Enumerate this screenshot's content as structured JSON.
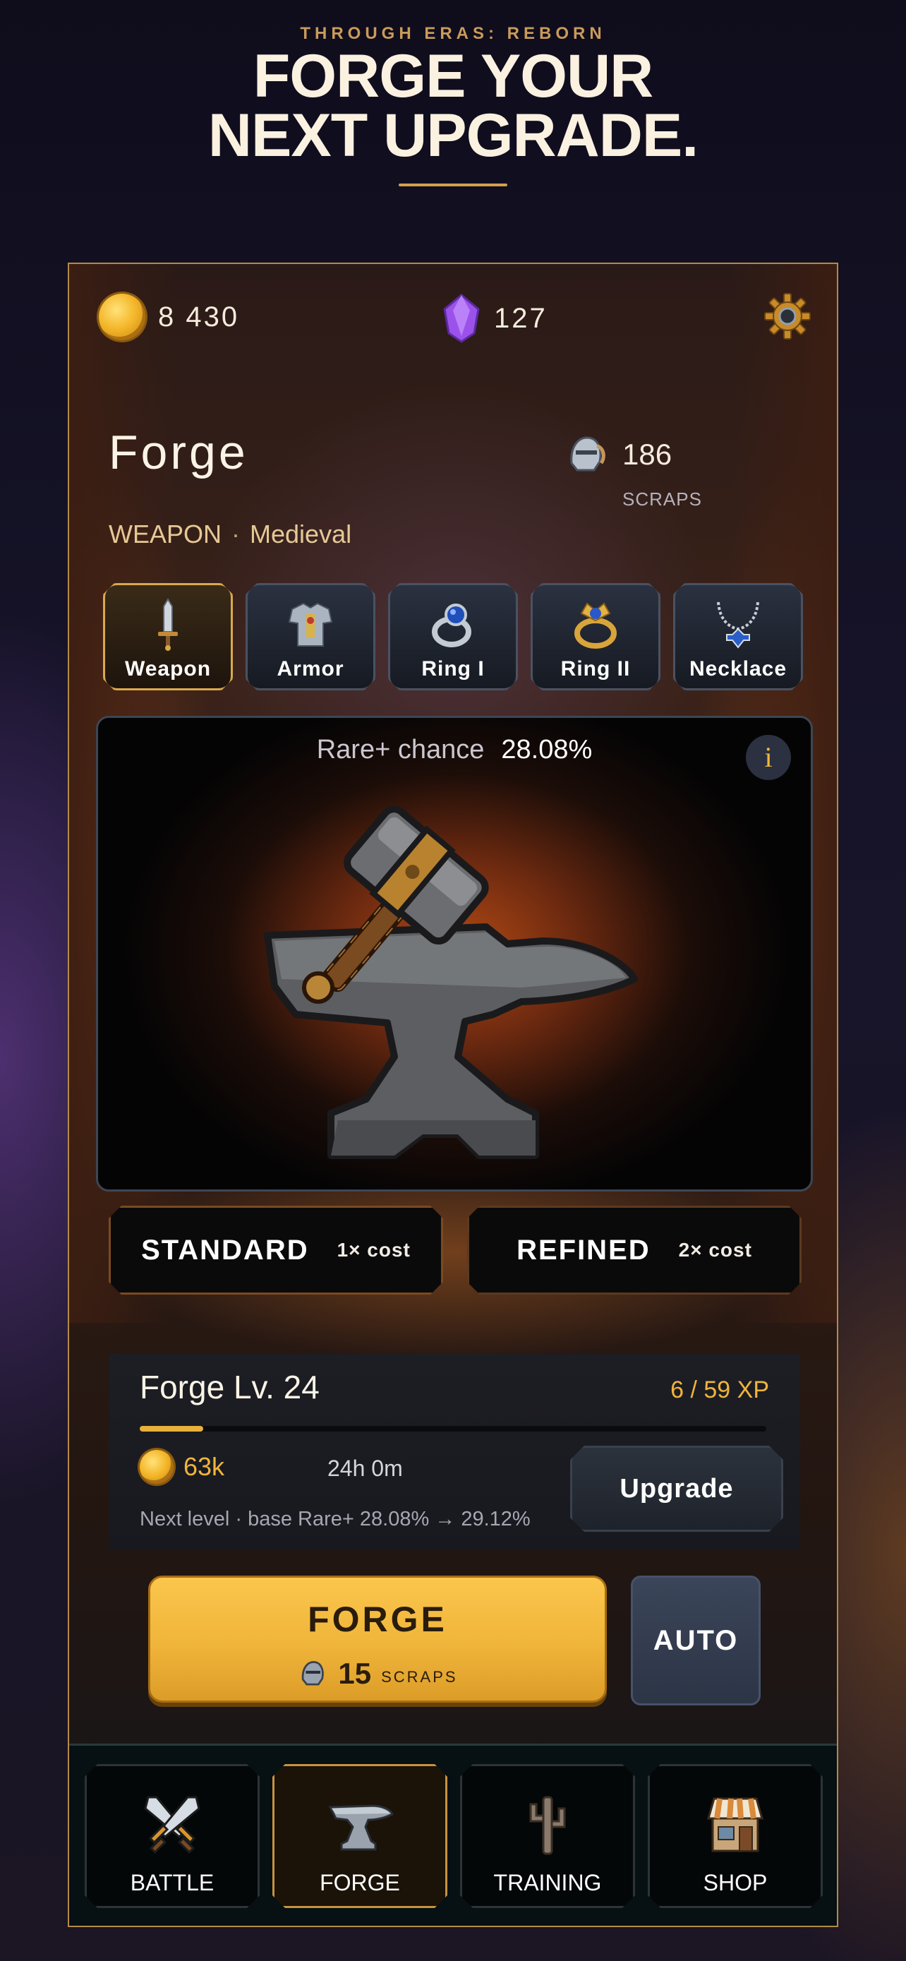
{
  "marketing": {
    "kicker": "THROUGH ERAS: REBORN",
    "headline_line1": "FORGE YOUR",
    "headline_line2": "NEXT UPGRADE."
  },
  "currencies": {
    "gold": "8 430",
    "gems": "127"
  },
  "forge": {
    "title": "Forge",
    "scraps_value": "186",
    "scraps_label": "SCRAPS",
    "category": "WEAPON",
    "separator": "·",
    "era": "Medieval"
  },
  "tabs": [
    {
      "label": "Weapon",
      "icon": "dagger-icon",
      "active": true
    },
    {
      "label": "Armor",
      "icon": "armor-icon",
      "active": false
    },
    {
      "label": "Ring I",
      "icon": "ring-icon",
      "active": false
    },
    {
      "label": "Ring II",
      "icon": "ring-gold-icon",
      "active": false
    },
    {
      "label": "Necklace",
      "icon": "necklace-icon",
      "active": false
    }
  ],
  "showcase": {
    "rare_label": "Rare+ chance",
    "rare_value": "28.08%",
    "info_label": "i"
  },
  "modes": {
    "standard": {
      "name": "STANDARD",
      "cost": "1× cost"
    },
    "refined": {
      "name": "REFINED",
      "cost": "2× cost"
    }
  },
  "level": {
    "title": "Forge Lv. 24",
    "xp": "6 / 59 XP",
    "xp_progress": 0.1017,
    "cost": "63k",
    "time": "24h 0m",
    "next": "Next level · base Rare+ 28.08% → 29.12%",
    "upgrade_label": "Upgrade"
  },
  "actions": {
    "forge_label": "FORGE",
    "forge_cost": "15",
    "forge_cost_unit": "SCRAPS",
    "auto_label": "AUTO"
  },
  "nav": [
    {
      "label": "BATTLE",
      "icon": "crossed-swords-icon",
      "active": false
    },
    {
      "label": "FORGE",
      "icon": "anvil-icon",
      "active": true
    },
    {
      "label": "TRAINING",
      "icon": "training-dummy-icon",
      "active": false
    },
    {
      "label": "SHOP",
      "icon": "shop-icon",
      "active": false
    }
  ],
  "colors": {
    "accent_gold": "#f0b43d",
    "frame_gold": "#b58a45",
    "gem_purple": "#a55cf0"
  }
}
